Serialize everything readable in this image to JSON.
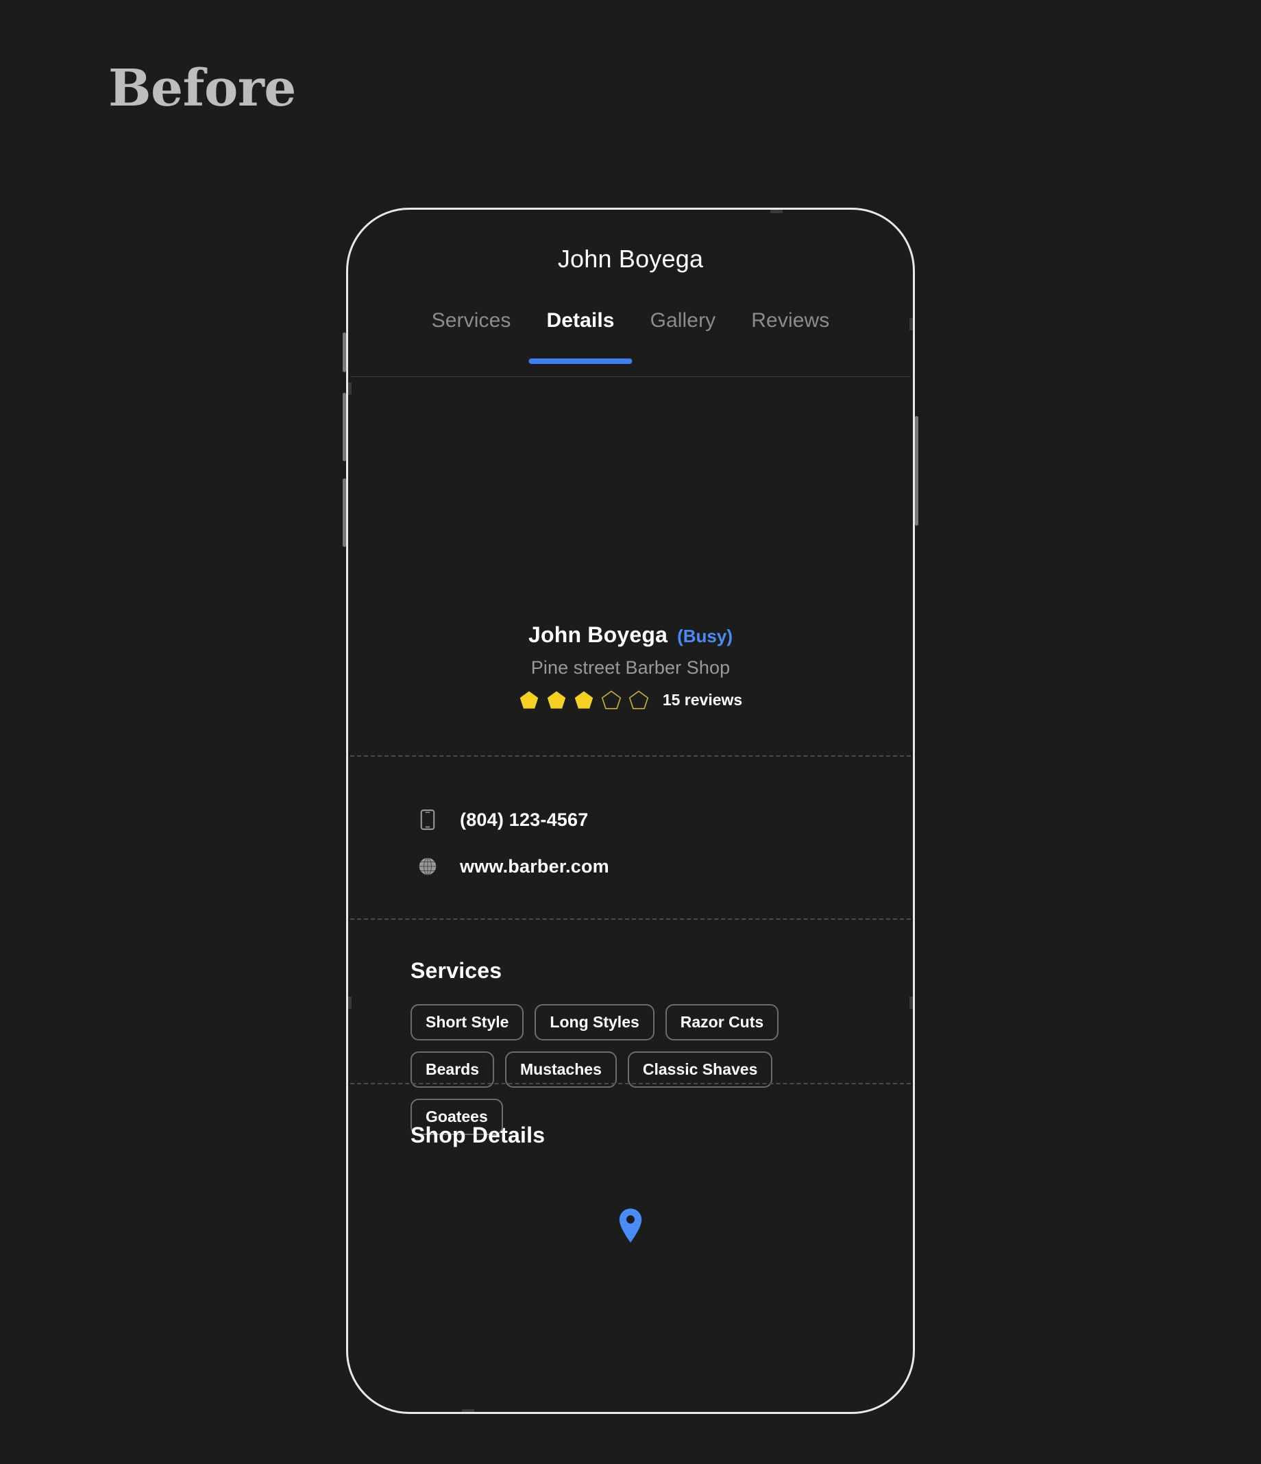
{
  "caption": "Before",
  "phone": {
    "app_title": "John Boyega",
    "tabs": [
      {
        "label": "Services",
        "active": false
      },
      {
        "label": "Details",
        "active": true
      },
      {
        "label": "Gallery",
        "active": false
      },
      {
        "label": "Reviews",
        "active": false
      }
    ],
    "profile": {
      "name": "John Boyega",
      "status": "(Busy)",
      "status_color": "#4a8cf7",
      "shop": "Pine street Barber Shop",
      "rating_filled": 3,
      "rating_total": 5,
      "rating_color": "#f5d020",
      "reviews_text": "15 reviews"
    },
    "contact": [
      {
        "icon": "mobile-phone-icon",
        "text": "(804) 123-4567"
      },
      {
        "icon": "globe-icon",
        "text": "www.barber.com"
      }
    ],
    "services": {
      "title": "Services",
      "chips": [
        "Short Style",
        "Long Styles",
        "Razor Cuts",
        "Beards",
        "Mustaches",
        "Classic Shaves",
        "Goatees"
      ]
    },
    "shop_details": {
      "title": "Shop Details",
      "map_pin_color": "#4a8cf7"
    }
  },
  "theme": {
    "background": "#1c1c1c",
    "accent": "#3b7ff0",
    "frame_border": "#e8e8e8"
  }
}
